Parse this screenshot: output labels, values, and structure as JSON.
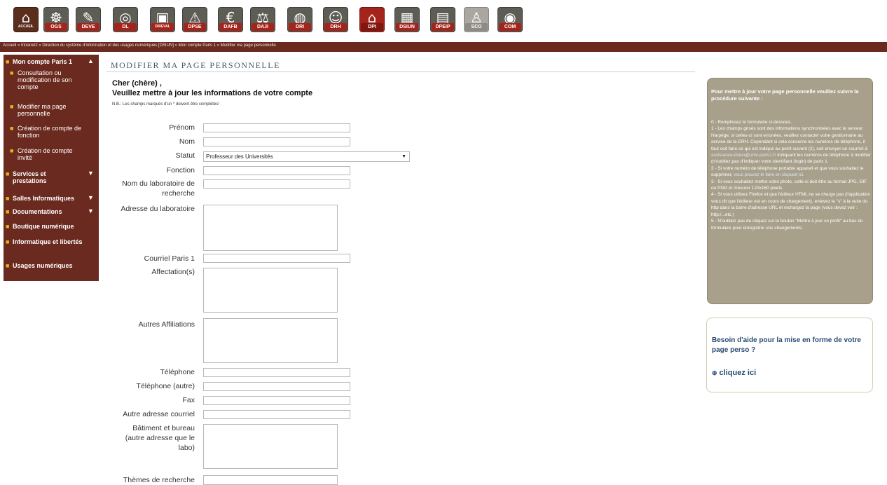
{
  "topbar": {
    "icons": [
      {
        "name": "home-icon",
        "tag": "ACCUEIL",
        "glyph": "⌂"
      },
      {
        "name": "ogs-icon",
        "tag": "OGS",
        "glyph": "☸"
      },
      {
        "name": "deve-icon",
        "tag": "DEVE",
        "glyph": "✎"
      },
      {
        "name": "dl-icon",
        "tag": "DL",
        "glyph": "◎"
      },
      {
        "name": "direval-icon",
        "tag": "DIREVAL",
        "glyph": "▣"
      },
      {
        "name": "dpse-icon",
        "tag": "DPSE",
        "glyph": "⚠"
      },
      {
        "name": "dafb-icon",
        "tag": "DAFB",
        "glyph": "€"
      },
      {
        "name": "daji-icon",
        "tag": "DAJI",
        "glyph": "⚖"
      },
      {
        "name": "dri-icon",
        "tag": "DRI",
        "glyph": "◍"
      },
      {
        "name": "drh-icon",
        "tag": "DRH",
        "glyph": "☺"
      },
      {
        "name": "dpi-icon",
        "tag": "DPI",
        "glyph": "⌂"
      },
      {
        "name": "dsiun-icon",
        "tag": "DSIUN",
        "glyph": "▦"
      },
      {
        "name": "dpeip-icon",
        "tag": "DPEIP",
        "glyph": "▤"
      },
      {
        "name": "sco-icon",
        "tag": "SCO",
        "glyph": "♙"
      },
      {
        "name": "com-icon",
        "tag": "COM",
        "glyph": "◉"
      }
    ]
  },
  "breadcrumb": "Accueil » Intranet2 » Direction du système d'information et des usages numériques [DSIUN] » Mon compte Paris 1 » Modifier ma page personnelle",
  "sidebar": {
    "sections": [
      {
        "label": "Mon compte Paris 1",
        "chevron": "▲"
      },
      {
        "label": "Services et prestations",
        "chevron": "▼"
      },
      {
        "label": "Salles Informatiques",
        "chevron": "▼"
      },
      {
        "label": "Documentations",
        "chevron": "▼"
      },
      {
        "label": "Boutique numérique",
        "chevron": ""
      },
      {
        "label": "Informatique et libertés",
        "chevron": ""
      },
      {
        "label": "Usages numériques",
        "chevron": ""
      }
    ],
    "subitems": [
      "Consultation ou modification de son compte",
      "Modifier ma page personnelle",
      "Création de compte de fonction",
      "Création de compte invité"
    ]
  },
  "main": {
    "title": "MODIFIER MA PAGE PERSONNELLE",
    "greeting": "Cher (chère) ,",
    "subtitle": "Veuillez mettre à jour les informations de votre compte",
    "note": "N.B.: Les champs marqués d'un * doivent être complétés!",
    "fields": {
      "prenom": "Prénom",
      "nom": "Nom",
      "statut": "Statut",
      "statut_value": "Professeur des Universités",
      "fonction": "Fonction",
      "labo_nom": "Nom du laboratoire de recherche",
      "labo_adresse": "Adresse du laboratoire",
      "courriel": "Courriel Paris 1",
      "affectations": "Affectation(s)",
      "affiliations": "Autres Affiliations",
      "telephone": "Téléphone",
      "telephone_autre": "Téléphone (autre)",
      "fax": "Fax",
      "autre_courriel": "Autre adresse courriel",
      "batiment": "Bâtiment et bureau (autre adresse que le labo)",
      "themes": "Thèmes de recherche"
    }
  },
  "instructions": {
    "title": "Pour mettre à jour votre page personnelle veuillez suivre la procédure suivante :",
    "p0": "0 - Remplissez le formulaire ci-dessous.",
    "p1a": "1 - Les champs grisés sont des informations synchronisées avec le serveur Harpège, si celles-ci sont erronées, veuillez contacter votre gestionnaire au service de la DRH. Cependant si cela concerne les numéros de téléphone, il faut soit faire ce qui est indiqué au point suivant (2), soit envoyer un courriel à",
    "p1link": "assistance-dsiun@univ-paris1.fr",
    "p1b": "indiquant les numéros de téléphone à modifier (n'oubliez pas d'indiquer votre identifiant (login) de paris 1.",
    "p2a": "2 - Si votre numéro de téléphone portable apparaît et que vous souhaitez le supprimer,",
    "p2link": "vous pouvez le faire en cliquant ici.",
    "p3": "3 - Si vous souhaitez mettre votre photo, celle-ci doit être au format JPG, GIF ou PNG et mesurer 120x160 pixels.",
    "p4": "4 - Si vous utilisez Firefox et que l'éditeur HTML ne se charge pas (l'application vous dit que l'éditeur est en cours de chargement), enlevez le \"s\" à la suite du http dans la barre d'adresse URL et rechargez la page (vous devez voir : http:/...etc.)",
    "p5": "5 - N'oubliez pas de cliquez sur le bouton \"Mettre à jour ce profil\" au bas du formulaire pour enregistrer vos changements."
  },
  "help": {
    "title": "Besoin d'aide pour la mise en forme de votre page perso ?",
    "link": "cliquez ici",
    "link_icon": "info-circle-icon"
  }
}
